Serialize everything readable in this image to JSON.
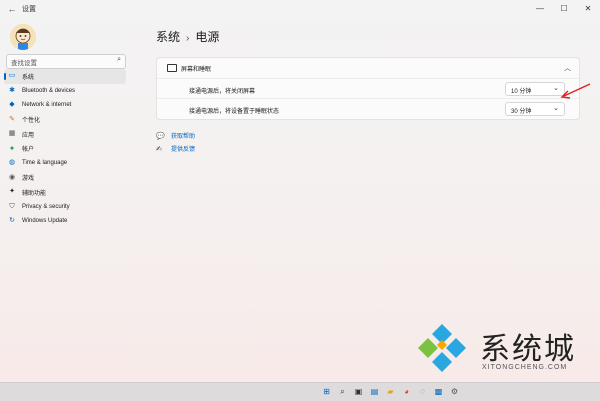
{
  "app": {
    "title": "设置",
    "back_glyph": "←"
  },
  "window_controls": {
    "minimize": "—",
    "maximize": "☐",
    "close": "✕"
  },
  "search": {
    "placeholder": "查找设置"
  },
  "sidebar": {
    "items": [
      {
        "label": "系统",
        "icon": "monitor-icon",
        "glyph": "▭",
        "color": "#0067c0",
        "active": true
      },
      {
        "label": "Bluetooth & devices",
        "icon": "bluetooth-icon",
        "glyph": "✱",
        "color": "#0067c0"
      },
      {
        "label": "Network & internet",
        "icon": "wifi-icon",
        "glyph": "◆",
        "color": "#0067c0"
      },
      {
        "label": "个性化",
        "icon": "brush-icon",
        "glyph": "✎",
        "color": "#d97706"
      },
      {
        "label": "应用",
        "icon": "apps-icon",
        "glyph": "▦",
        "color": "#555555"
      },
      {
        "label": "帐户",
        "icon": "account-icon",
        "glyph": "●",
        "color": "#16a34a"
      },
      {
        "label": "Time & language",
        "icon": "globe-icon",
        "glyph": "◍",
        "color": "#0067c0"
      },
      {
        "label": "游戏",
        "icon": "game-icon",
        "glyph": "◉",
        "color": "#555555"
      },
      {
        "label": "辅助功能",
        "icon": "accessibility-icon",
        "glyph": "✦",
        "color": "#1b1b1b"
      },
      {
        "label": "Privacy & security",
        "icon": "shield-icon",
        "glyph": "⛉",
        "color": "#555555"
      },
      {
        "label": "Windows Update",
        "icon": "update-icon",
        "glyph": "↻",
        "color": "#0067c0"
      }
    ]
  },
  "breadcrumb": {
    "parent": "系统",
    "separator": "›",
    "current": "电源"
  },
  "panel": {
    "title": "屏幕和睡眠",
    "collapse_glyph": "︿",
    "rows": [
      {
        "label": "接通电源后，将关闭屏幕",
        "value": "10 分钟"
      },
      {
        "label": "接通电源后，将设备置于睡眠状态",
        "value": "30 分钟"
      }
    ]
  },
  "links": [
    {
      "label": "获取帮助",
      "icon": "help-icon",
      "glyph": "💬"
    },
    {
      "label": "提供反馈",
      "icon": "feedback-icon",
      "glyph": "✍"
    }
  ],
  "watermark": {
    "text": "系统城",
    "sub": "XITONGCHENG.COM"
  },
  "taskbar": {
    "icons": [
      {
        "name": "start-icon",
        "glyph": "⊞",
        "color": "#0067c0"
      },
      {
        "name": "search-icon",
        "glyph": "⌕",
        "color": "#333333"
      },
      {
        "name": "task-view-icon",
        "glyph": "▣",
        "color": "#333333"
      },
      {
        "name": "widgets-icon",
        "glyph": "▤",
        "color": "#0067c0"
      },
      {
        "name": "explorer-icon",
        "glyph": "▰",
        "color": "#e5a50a"
      },
      {
        "name": "chrome-icon",
        "glyph": "◕",
        "color": "#db4437"
      },
      {
        "name": "edge-icon",
        "glyph": "◌",
        "color": "#0f9d58"
      },
      {
        "name": "store-icon",
        "glyph": "▩",
        "color": "#0067c0"
      },
      {
        "name": "settings-icon",
        "glyph": "⚙",
        "color": "#555555"
      }
    ]
  },
  "colors": {
    "accent": "#0067c0",
    "annotation_arrow": "#e0201e"
  }
}
